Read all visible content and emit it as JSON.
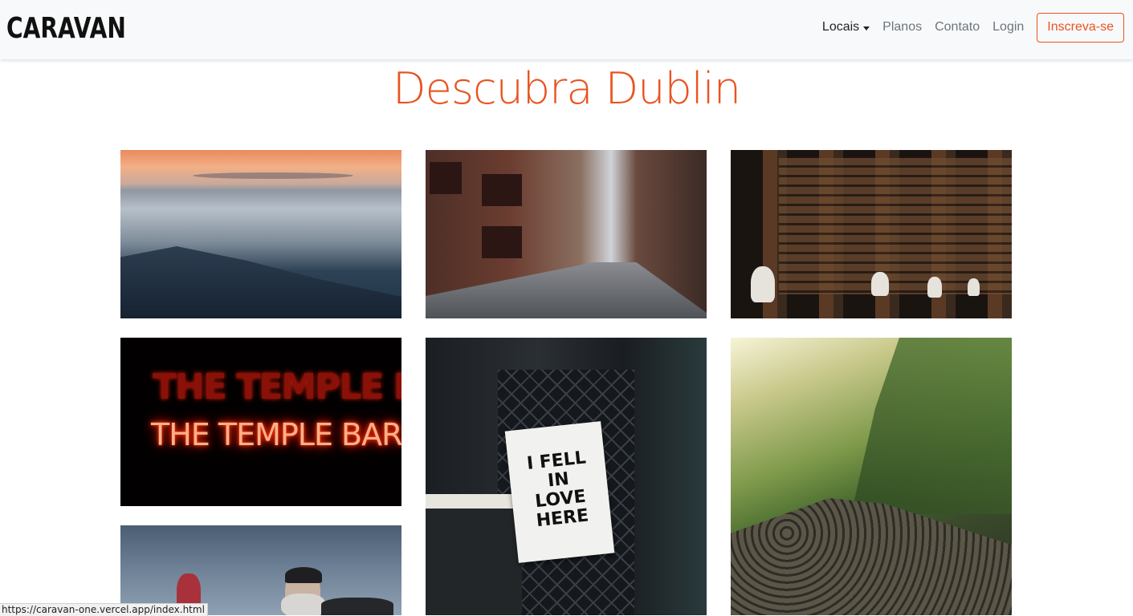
{
  "navbar": {
    "brand": "CARAVAN",
    "links": [
      {
        "label": "Locais",
        "active": true,
        "dropdown": true
      },
      {
        "label": "Planos"
      },
      {
        "label": "Contato"
      },
      {
        "label": "Login"
      }
    ],
    "signup_label": "Inscreva-se"
  },
  "page": {
    "title": "Descubra Dublin"
  },
  "gallery": {
    "photos": [
      {
        "subject": "coastal-sunset-rocks"
      },
      {
        "subject": "city-street-the-dubliner"
      },
      {
        "subject": "library-bookshelves-busts"
      },
      {
        "subject": "neon-sign",
        "sign_top": "THE TEMPLE BAR",
        "sign_main": "THE TEMPLE BAR"
      },
      {
        "subject": "poster-hanger",
        "poster_lines": [
          "I FELL",
          "IN",
          "LOVE",
          "HERE"
        ]
      },
      {
        "subject": "green-hills-basalt-columns"
      },
      {
        "subject": "bearded-man-sky"
      }
    ]
  },
  "statusbar": {
    "url": "https://caravan-one.vercel.app/index.html"
  },
  "colors": {
    "accent": "#e95420",
    "navbar_bg": "#f8f9fa",
    "nav_link": "#6c757d",
    "nav_link_active": "#212529"
  }
}
